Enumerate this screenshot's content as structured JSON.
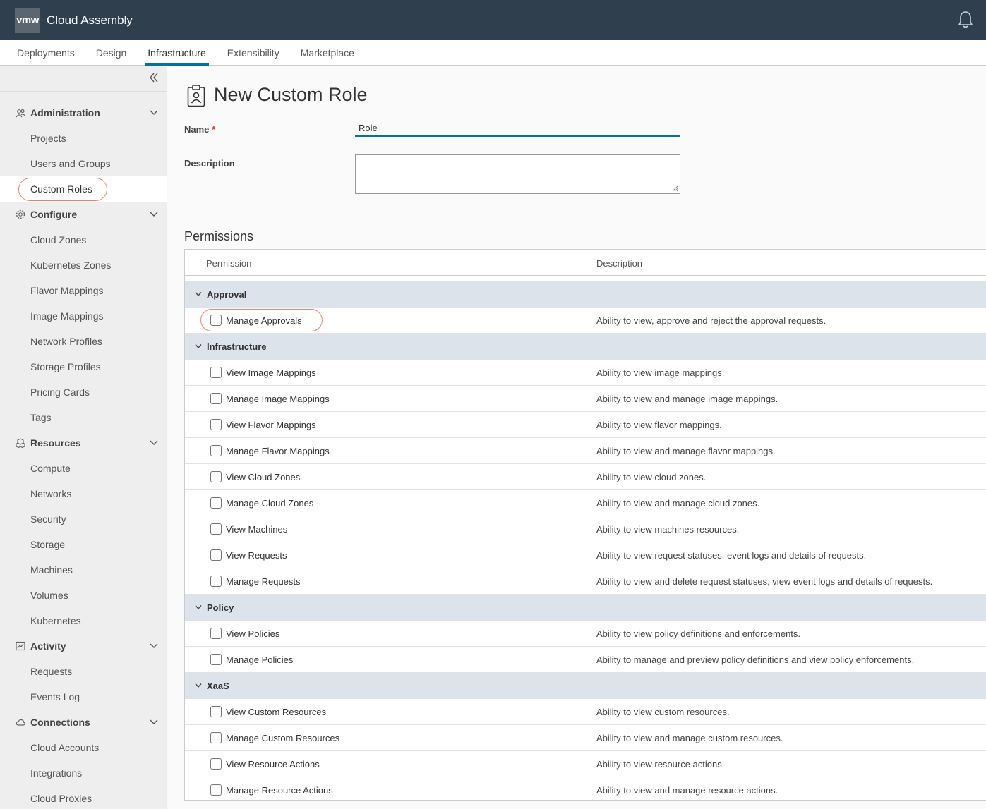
{
  "header": {
    "logo_text": "vmw",
    "app_title": "Cloud Assembly"
  },
  "nav": {
    "tabs": [
      {
        "label": "Deployments"
      },
      {
        "label": "Design"
      },
      {
        "label": "Infrastructure",
        "active": true
      },
      {
        "label": "Extensibility"
      },
      {
        "label": "Marketplace"
      }
    ]
  },
  "sidebar": {
    "groups": [
      {
        "label": "Administration",
        "icon": "users-icon",
        "items": [
          "Projects",
          "Users and Groups",
          "Custom Roles"
        ]
      },
      {
        "label": "Configure",
        "icon": "gear-icon",
        "items": [
          "Cloud Zones",
          "Kubernetes Zones",
          "Flavor Mappings",
          "Image Mappings",
          "Network Profiles",
          "Storage Profiles",
          "Pricing Cards",
          "Tags"
        ]
      },
      {
        "label": "Resources",
        "icon": "cubes-icon",
        "items": [
          "Compute",
          "Networks",
          "Security",
          "Storage",
          "Machines",
          "Volumes",
          "Kubernetes"
        ]
      },
      {
        "label": "Activity",
        "icon": "chart-icon",
        "items": [
          "Requests",
          "Events Log"
        ]
      },
      {
        "label": "Connections",
        "icon": "cloud-icon",
        "items": [
          "Cloud Accounts",
          "Integrations",
          "Cloud Proxies"
        ]
      }
    ],
    "active_item": "Custom Roles"
  },
  "form": {
    "title": "New Custom Role",
    "name_label": "Name",
    "name_required_mark": "*",
    "name_value": "Role",
    "description_label": "Description",
    "description_value": ""
  },
  "permissions": {
    "section_title": "Permissions",
    "col_permission": "Permission",
    "col_description": "Description",
    "categories": [
      {
        "name": "Approval",
        "items": [
          {
            "name": "Manage Approvals",
            "description": "Ability to view, approve and reject the approval requests."
          }
        ]
      },
      {
        "name": "Infrastructure",
        "items": [
          {
            "name": "View Image Mappings",
            "description": "Ability to view image mappings."
          },
          {
            "name": "Manage Image Mappings",
            "description": "Ability to view and manage image mappings."
          },
          {
            "name": "View Flavor Mappings",
            "description": "Ability to view flavor mappings."
          },
          {
            "name": "Manage Flavor Mappings",
            "description": "Ability to view and manage flavor mappings."
          },
          {
            "name": "View Cloud Zones",
            "description": "Ability to view cloud zones."
          },
          {
            "name": "Manage Cloud Zones",
            "description": "Ability to view and manage cloud zones."
          },
          {
            "name": "View Machines",
            "description": "Ability to view machines resources."
          },
          {
            "name": "View Requests",
            "description": "Ability to view request statuses, event logs and details of requests."
          },
          {
            "name": "Manage Requests",
            "description": "Ability to view and delete request statuses, view event logs and details of requests."
          }
        ]
      },
      {
        "name": "Policy",
        "items": [
          {
            "name": "View Policies",
            "description": "Ability to view policy definitions and enforcements."
          },
          {
            "name": "Manage Policies",
            "description": "Ability to manage and preview policy definitions and view policy enforcements."
          }
        ]
      },
      {
        "name": "XaaS",
        "items": [
          {
            "name": "View Custom Resources",
            "description": "Ability to view custom resources."
          },
          {
            "name": "Manage Custom Resources",
            "description": "Ability to view and manage custom resources."
          },
          {
            "name": "View Resource Actions",
            "description": "Ability to view resource actions."
          },
          {
            "name": "Manage Resource Actions",
            "description": "Ability to view and manage resource actions."
          }
        ]
      }
    ]
  },
  "colors": {
    "header_bg": "#303f4d",
    "accent": "#0072a3",
    "highlight_ring": "#f08066",
    "category_bg": "#dde3ea"
  }
}
